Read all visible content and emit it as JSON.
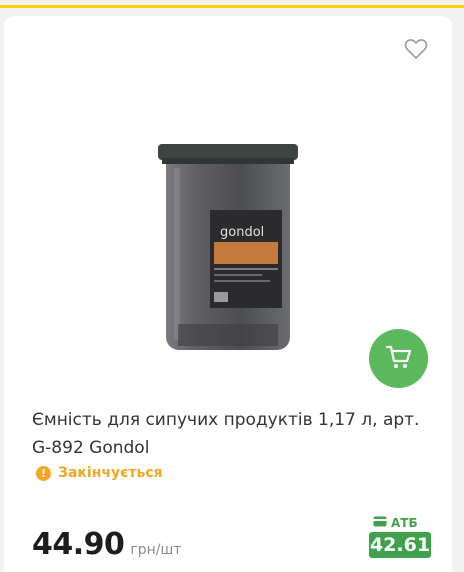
{
  "product": {
    "title": "Ємність для сипучих продуктів 1,17 л, арт. G-892 Gondol",
    "status": "Закінчується",
    "price": "44.90",
    "price_unit": "грн/шт",
    "loyalty_label": "АТБ",
    "loyalty_price": "42.61",
    "brand_label": "gondol"
  },
  "icons": {
    "favorite": "heart-outline-icon",
    "cart": "cart-icon",
    "status": "warning-icon",
    "loyalty": "wallet-icon"
  },
  "colors": {
    "accent_yellow": "#ffd200",
    "cart_green": "#5cb85c",
    "status_orange": "#f5a623",
    "loyalty_green": "#3fa14c"
  }
}
